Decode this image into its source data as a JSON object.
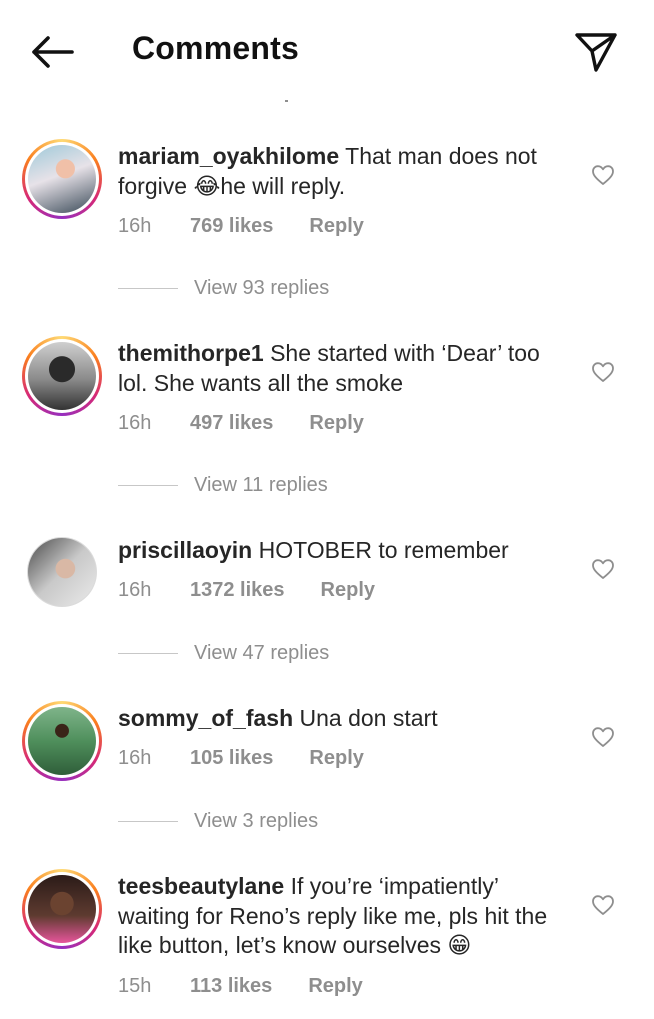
{
  "header": {
    "title": "Comments",
    "back_icon": "arrow-left-icon",
    "send_icon": "paper-plane-icon"
  },
  "comments": [
    {
      "username": "mariam_oyakhilome",
      "text_before": "That man does not forgive ",
      "emoji": "😂",
      "text_after": "he will reply.",
      "time": "16h",
      "likes": "769 likes",
      "reply_label": "Reply",
      "view_replies": "View 93 replies",
      "story_ring": true
    },
    {
      "username": "themithorpe1",
      "text_before": "She started with ‘Dear’ too lol. She wants all the smoke",
      "time": "16h",
      "likes": "497 likes",
      "reply_label": "Reply",
      "view_replies": "View 11 replies",
      "story_ring": true
    },
    {
      "username": "priscillaoyin",
      "text_before": "HOTOBER to remember",
      "time": "16h",
      "likes": "1372 likes",
      "reply_label": "Reply",
      "view_replies": "View 47 replies",
      "story_ring": false
    },
    {
      "username": "sommy_of_fash",
      "text_before": "Una don start",
      "time": "16h",
      "likes": "105 likes",
      "reply_label": "Reply",
      "view_replies": "View 3 replies",
      "story_ring": true
    },
    {
      "username": "teesbeautylane",
      "text_before": "If you’re ‘impatiently’ waiting for Reno’s reply like me, pls hit the like button, let’s know ourselves ",
      "emoji": "😁",
      "time": "15h",
      "likes": "113 likes",
      "reply_label": "Reply",
      "story_ring": true
    }
  ],
  "colors": {
    "text": "#262626",
    "secondary": "#8e8e8e",
    "divider": "#c7c7c7"
  }
}
